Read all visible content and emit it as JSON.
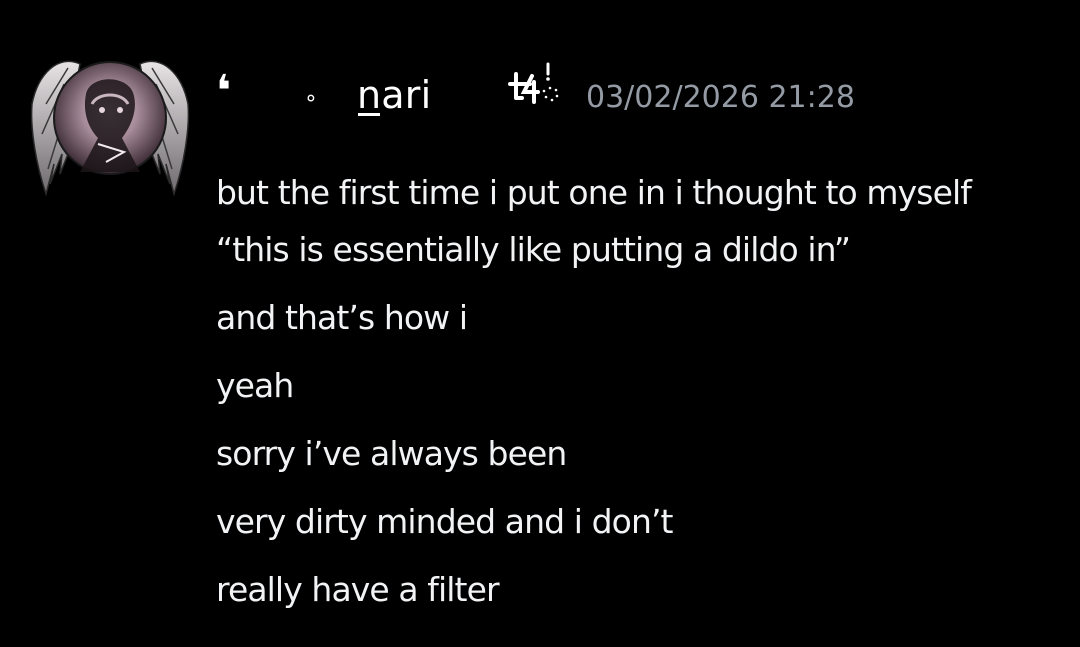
{
  "message": {
    "author": {
      "prefix_glyph": "❛",
      "ring_glyph": "∘",
      "name_first": "n",
      "name_rest": "ari",
      "tag_icon": "sparkle-tag-icon",
      "avatar_icon": "winged-avatar"
    },
    "timestamp": "03/02/2026 21:28",
    "lines": [
      "but the first time i put one in i thought to myself",
      "“this is essentially like putting a dildo in”",
      "and that’s how i",
      "yeah",
      "sorry i’ve always been",
      "very dirty minded and i don’t",
      "really have a filter"
    ]
  },
  "colors": {
    "background": "#000000",
    "text": "#f2f3f5",
    "timestamp": "#949ba4",
    "username": "#ffffff"
  }
}
